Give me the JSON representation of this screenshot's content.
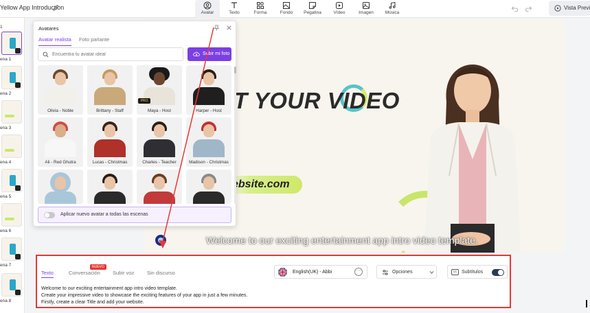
{
  "header": {
    "project_title": "Yellow App Introduction",
    "tools": [
      {
        "label": "Avatar",
        "icon": "avatar-icon"
      },
      {
        "label": "Texto",
        "icon": "text-icon"
      },
      {
        "label": "Forma",
        "icon": "shapes-icon"
      },
      {
        "label": "Fondo",
        "icon": "background-icon"
      },
      {
        "label": "Pegatina",
        "icon": "sticker-icon"
      },
      {
        "label": "Vídeo",
        "icon": "video-icon"
      },
      {
        "label": "Imagen",
        "icon": "image-icon"
      },
      {
        "label": "Música",
        "icon": "music-icon"
      }
    ],
    "active_tool": "Avatar",
    "preview_label": "Vista Previa"
  },
  "scenes": {
    "first_number": "1",
    "items": [
      {
        "label": "ena 1"
      },
      {
        "label": "ena 2"
      },
      {
        "label": "ena 3"
      },
      {
        "label": "ena 4"
      },
      {
        "label": "ena 5"
      },
      {
        "label": "ena 6"
      },
      {
        "label": "ena 7"
      },
      {
        "label": "ena 8"
      }
    ]
  },
  "avatar_panel": {
    "title": "Avatares",
    "tabs": [
      "Avatar realista",
      "Foto parlante"
    ],
    "active_tab": "Avatar realista",
    "search_placeholder": "Encuentra tu avatar ideal",
    "upload_label": "Subir mi foto",
    "pro_badge": "PRO",
    "avatars": [
      {
        "name": "Olivia - Noble"
      },
      {
        "name": "Brittany - Staff"
      },
      {
        "name": "Maya - Host"
      },
      {
        "name": "Harper - Host"
      },
      {
        "name": "Ali - Red Ghutra"
      },
      {
        "name": "Lucas - Christmas"
      },
      {
        "name": "Charles - Teacher"
      },
      {
        "name": "Madison - Christmas"
      }
    ],
    "apply_all_label": "Aplicar nuevo avatar a todas las escenas"
  },
  "canvas": {
    "headline": "T YOUR VIDEO",
    "website_text": "ebsite.com",
    "caption": "Welcome to our exciting entertainment app intro video template."
  },
  "script_panel": {
    "tabs": [
      "Texto",
      "Conversación",
      "Subir voz",
      "Sin discurso"
    ],
    "active_tab": "Texto",
    "new_badge": "NUEVO",
    "voice_label": "English(UK) - Abbi",
    "options_label": "Opciones",
    "subtitles_label": "Subtítulos",
    "subtitles_on": true,
    "script_lines": [
      "Welcome to our exciting entertainment app intro video template.",
      "Create your impressive video to showcase the exciting features of your app in just a few minutes.",
      "Firstly, create a clear Title and add your website."
    ]
  },
  "colors": {
    "accent": "#7b3fe4",
    "annotation_red": "#e53935"
  }
}
